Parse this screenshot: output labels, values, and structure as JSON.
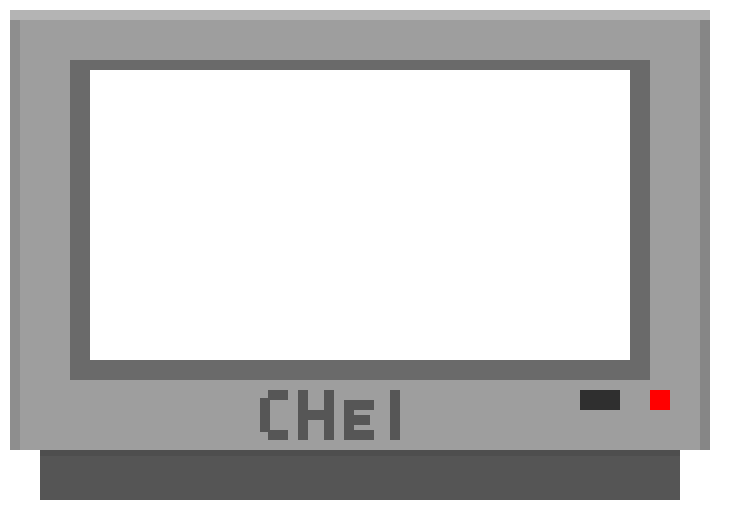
{
  "tv": {
    "brand_logo_text": "CHEI",
    "screen_color": "#ffffff",
    "power_button_color": "#2f2f2f",
    "power_led_color": "#ff0000",
    "cabinet_color": "#9e9e9e",
    "bezel_color": "#6a6a6a",
    "stand_color": "#555555",
    "logo_color": "#565656"
  }
}
